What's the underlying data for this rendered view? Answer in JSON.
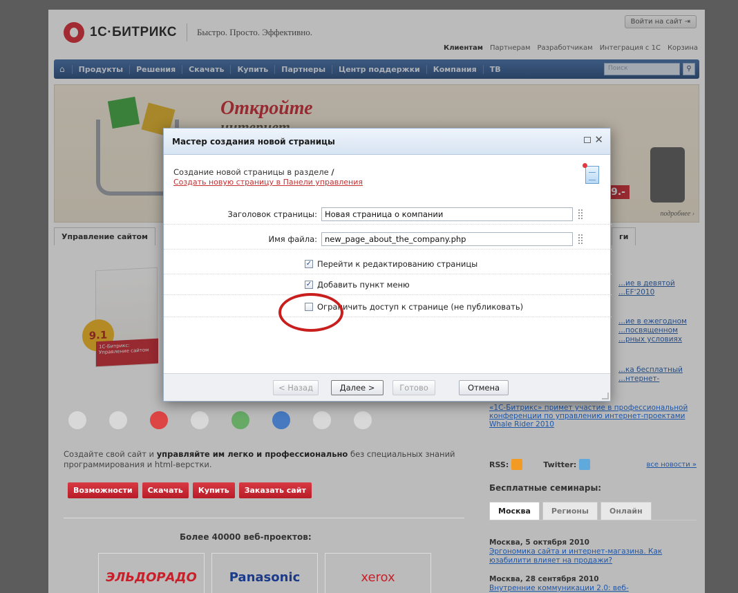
{
  "site": {
    "logo_text": "1С·БИТРИКС",
    "slogan": "Быстро. Просто. Эффективно.",
    "login_button": "Войти на сайт",
    "top_links": [
      "Клиентам",
      "Партнерам",
      "Разработчикам",
      "Интеграция с 1С",
      "Корзина"
    ],
    "nav_items": [
      "Продукты",
      "Решения",
      "Скачать",
      "Купить",
      "Партнеры",
      "Центр поддержки",
      "Компания",
      "ТВ"
    ],
    "search_placeholder": "Поиск",
    "banner_title": "Откройте",
    "banner_sub": "интернет",
    "banner_more": "подробнее ›",
    "banner_price": "9.-",
    "left_tab": "Управление сайтом",
    "right_tab": "ги",
    "product_version": "9.1",
    "product_label": "1С-Битрикс: Управление сайтом",
    "promo_text_1": "Создайте свой сайт и ",
    "promo_bold_1": "управляйте им легко и профессионально",
    "promo_text_2": " без специальных знаний программирования и html-верстки.",
    "buttons": [
      "Возможности",
      "Скачать",
      "Купить",
      "Заказать сайт"
    ],
    "projects_title": "Более 40000 веб-проектов:",
    "brand_logos": [
      "ЭЛЬДОРАДО",
      "Panasonic",
      "xerox"
    ],
    "news_links": [
      "...ие в девятой ...EF'2010",
      "...ие в ежегодном ...посвященном ...рных условиях",
      "...ка бесплатный ...нтернет-"
    ],
    "news_big": "«1С-Битрикс» примет участие в профессиональной конференции по управлению интернет-проектами Whale Rider 2010",
    "rss_label": "RSS:",
    "twitter_label": "Twitter:",
    "all_news": "все новости »",
    "seminars_title": "Бесплатные семинары:",
    "seminar_tabs": [
      "Москва",
      "Регионы",
      "Онлайн"
    ],
    "seminars": [
      {
        "date": "Москва, 5 октября 2010",
        "title": "Эргономика сайта и интернет-магазина. Как юзабилити влияет на продажи?"
      },
      {
        "date": "Москва, 28 сентября 2010",
        "title": "Внутренние коммуникации 2.0: веб-"
      }
    ]
  },
  "dialog": {
    "title": "Мастер создания новой страницы",
    "description": "Создание новой страницы в разделе",
    "section_path": "/",
    "panel_link": "Создать новую страницу в Панели управления",
    "fields": {
      "page_title_label": "Заголовок страницы:",
      "page_title_value": "Новая страница о компании",
      "file_name_label": "Имя файла:",
      "file_name_value": "new_page_about_the_company.php"
    },
    "checkboxes": [
      {
        "label": "Перейти к редактированию страницы",
        "checked": true
      },
      {
        "label": "Добавить пункт меню",
        "checked": true
      },
      {
        "label": "Ограничить доступ к странице (не публиковать)",
        "checked": false
      }
    ],
    "buttons": {
      "back": "< Назад",
      "next": "Далее >",
      "done": "Готово",
      "cancel": "Отмена"
    }
  }
}
